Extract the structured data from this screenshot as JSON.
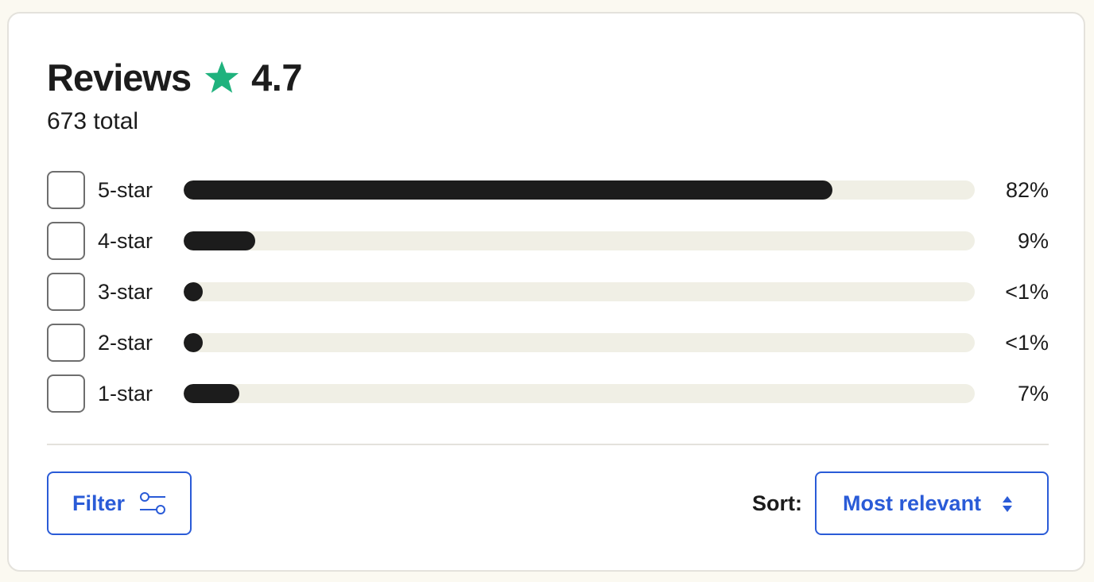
{
  "reviews": {
    "title": "Reviews",
    "rating": "4.7",
    "total": "673 total",
    "accent_color": "#1fb27d",
    "rating_icon": "star-icon",
    "breakdown": [
      {
        "label": "5-star",
        "percent_text": "82%",
        "fill_percent": 82
      },
      {
        "label": "4-star",
        "percent_text": "9%",
        "fill_percent": 9
      },
      {
        "label": "3-star",
        "percent_text": "<1%",
        "fill_percent": 0.5
      },
      {
        "label": "2-star",
        "percent_text": "<1%",
        "fill_percent": 0.5
      },
      {
        "label": "1-star",
        "percent_text": "7%",
        "fill_percent": 7
      }
    ]
  },
  "controls": {
    "filter_label": "Filter",
    "filter_icon": "sliders-icon",
    "sort_label": "Sort:",
    "sort_value": "Most relevant",
    "sort_icon": "sort-arrows-icon",
    "link_color": "#2a5bd7"
  }
}
